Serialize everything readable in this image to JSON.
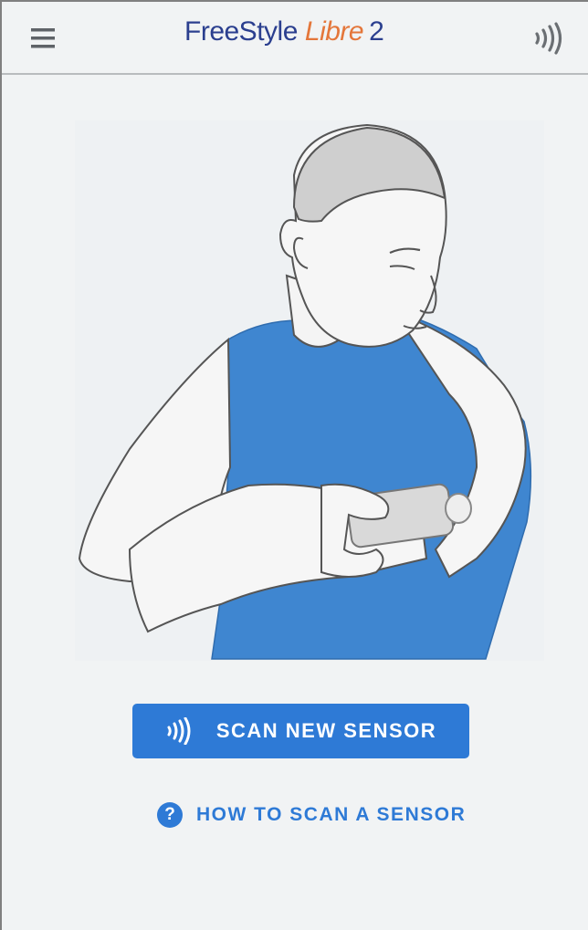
{
  "header": {
    "brand_freestyle": "FreeStyle",
    "brand_libre": "Libre",
    "brand_number": "2",
    "menu_icon": "hamburger-menu-icon",
    "scan_icon": "nfc-scan-icon"
  },
  "main": {
    "illustration_icon": "person-scanning-arm-sensor-illustration",
    "scan_button_label": "SCAN NEW SENSOR",
    "scan_button_icon": "nfc-scan-icon",
    "help_link_label": "HOW TO SCAN A SENSOR",
    "help_icon_glyph": "?",
    "help_icon": "question-circle-icon"
  },
  "colors": {
    "accent_blue": "#2e7ad6",
    "brand_navy": "#2b3f8f",
    "brand_orange": "#e4763a",
    "shirt_blue": "#3f86d0",
    "background": "#f1f3f4"
  }
}
